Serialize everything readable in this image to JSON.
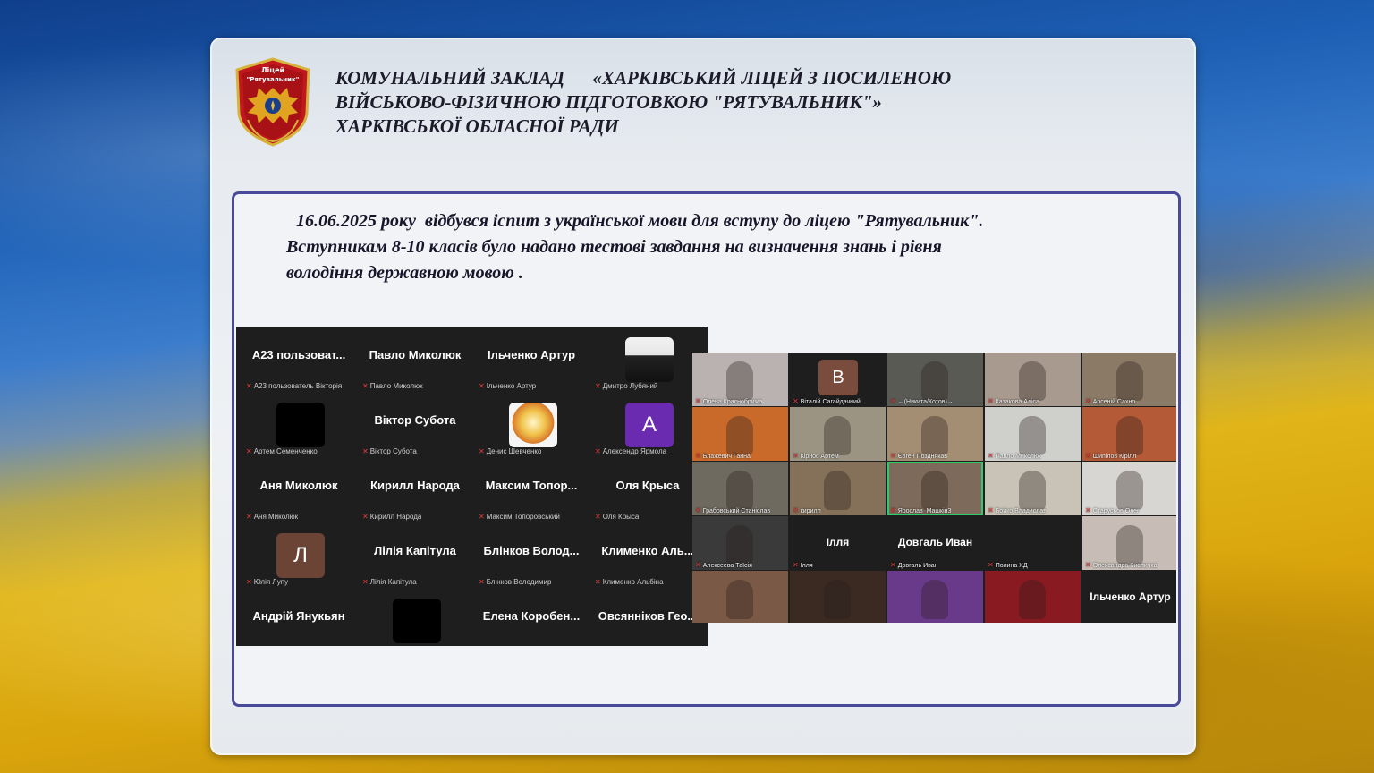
{
  "header": {
    "emblem_text": "Ліцей \"Рятувальник\"",
    "lines": [
      "КОМУНАЛЬНИЙ ЗАКЛАД      «ХАРКІВСЬКИЙ ЛІЦЕЙ З ПОСИЛЕНОЮ",
      "ВІЙСЬКОВО-ФІЗИЧНОЮ ПІДГОТОВКОЮ \"РЯТУВАЛЬНИК\"»",
      "ХАРКІВСЬКОЇ ОБЛАСНОЇ РАДИ"
    ]
  },
  "intro": {
    "line1": " 16.06.2025 року  відбувся іспит з української мови для вступу до ліцею \"Рятувальник\".",
    "line2": "Вступникам 8-10  класів   було надано тестові завдання на визначення знань і  рівня",
    "line3": "володіння державною мовою ."
  },
  "zoom_left": {
    "tiles": [
      {
        "name": "А23  пользоват...",
        "caption": "А23 пользователь Вікторія",
        "avatar": ""
      },
      {
        "name": "Павло Миколюк",
        "caption": "Павло Миколюк",
        "avatar": ""
      },
      {
        "name": "Ільченко Артур",
        "caption": "Ільченко Артур",
        "avatar": ""
      },
      {
        "name": "",
        "caption": "Дмитро Лубяний",
        "avatar": "photo"
      },
      {
        "name": "",
        "caption": "Артем Семенченко",
        "avatar": "dark"
      },
      {
        "name": "Віктор Субота",
        "caption": "Віктор Субота",
        "avatar": ""
      },
      {
        "name": "",
        "caption": "Денис Шевченко",
        "avatar": "fire"
      },
      {
        "name": "",
        "caption": "Алексендр Ярмола",
        "avatar": "А"
      },
      {
        "name": "Аня Миколюк",
        "caption": "Аня Миколюк",
        "avatar": ""
      },
      {
        "name": "Кирилл Народа",
        "caption": "Кирилл Народа",
        "avatar": ""
      },
      {
        "name": "Максим  Топор...",
        "caption": "Максим Топоровський",
        "avatar": ""
      },
      {
        "name": "Оля Крыса",
        "caption": "Оля Крыса",
        "avatar": ""
      },
      {
        "name": "",
        "caption": "Юлія Лупу",
        "avatar": "Л"
      },
      {
        "name": "Лілія Капітула",
        "caption": "Лілія Капітула",
        "avatar": ""
      },
      {
        "name": "Блінков  Волод...",
        "caption": "Блінков Володимир",
        "avatar": ""
      },
      {
        "name": "Клименко  Аль...",
        "caption": "Клименко Альбіна",
        "avatar": ""
      },
      {
        "name": "Андрій Янукьян",
        "caption": "",
        "avatar": ""
      },
      {
        "name": "",
        "caption": "",
        "avatar": "dark"
      },
      {
        "name": "Елена  Коробен...",
        "caption": "",
        "avatar": ""
      },
      {
        "name": "Овсянніков  Гео...",
        "caption": "",
        "avatar": ""
      }
    ]
  },
  "zoom_right": {
    "tiles": [
      {
        "caption": "Олена Краснобрижа",
        "name": "",
        "bg": "#b9b2b0"
      },
      {
        "caption": "Віталій Сагайдачний",
        "name": "",
        "bg": "#1e1e1e",
        "avatar": "В"
      },
      {
        "caption": "←(Никита/Котов)→",
        "name": "",
        "bg": "#5a5a55"
      },
      {
        "caption": "Казакова Аліса",
        "name": "",
        "bg": "#a89a8e"
      },
      {
        "caption": "Арсеній Сахно",
        "name": "",
        "bg": "#8a7a66"
      },
      {
        "caption": "Блажевич Ганна",
        "name": "",
        "bg": "#c96a2b"
      },
      {
        "caption": "Кірнос Артем",
        "name": "",
        "bg": "#9b9483"
      },
      {
        "caption": "Євген Позднякав",
        "name": "",
        "bg": "#a38d73"
      },
      {
        "caption": "Павло Миколюк",
        "name": "",
        "bg": "#cfd0cc"
      },
      {
        "caption": "Шипілов Кірілл",
        "name": "",
        "bg": "#b45a36"
      },
      {
        "caption": "Грабовський Станіслав",
        "name": "",
        "bg": "#6e6a60"
      },
      {
        "caption": "кирилл",
        "name": "",
        "bg": "#85715a"
      },
      {
        "caption": "Ярослав_Машкін3",
        "name": "",
        "bg": "#7d6a5a",
        "highlight": true
      },
      {
        "caption": "Бойко Владислав",
        "name": "",
        "bg": "#c8c3b6"
      },
      {
        "caption": "Старусьов Олег",
        "name": "",
        "bg": "#d8d6d2"
      },
      {
        "caption": "Алексеева Таїсія",
        "name": "",
        "bg": "#3a3a3a"
      },
      {
        "caption": "Ілля",
        "name": "Ілля",
        "bg": "#1e1e1e"
      },
      {
        "caption": "Довгаль Иван",
        "name": "Довгаль Иван",
        "bg": "#1e1e1e"
      },
      {
        "caption": "Полина ХД",
        "name": "",
        "bg": "#1e1e1e"
      },
      {
        "caption": "Олександра Кисличка",
        "name": "",
        "bg": "#c7bdb6"
      },
      {
        "caption": "",
        "name": "",
        "bg": "#7a5a46"
      },
      {
        "caption": "",
        "name": "",
        "bg": "#3a2a22"
      },
      {
        "caption": "",
        "name": "",
        "bg": "#6a3a8a"
      },
      {
        "caption": "",
        "name": "",
        "bg": "#8a1a22"
      },
      {
        "caption": "",
        "name": "Ільченко Артур",
        "bg": "#1e1e1e"
      }
    ]
  },
  "colors": {
    "frame_border": "#4a4a9a",
    "zoom_bg": "#1e1e1e",
    "mic_muted": "#e23b3b"
  }
}
